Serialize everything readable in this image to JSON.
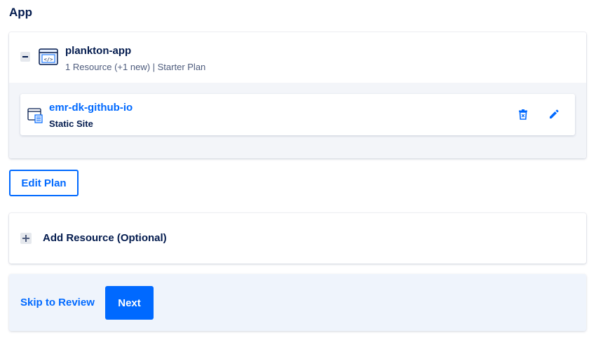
{
  "section": {
    "title": "App"
  },
  "app": {
    "name": "plankton-app",
    "meta": "1 Resource (+1 new) | Starter Plan",
    "icon": "code-window-icon",
    "collapse_icon": "minus-icon"
  },
  "resource": {
    "name": "emr-dk-github-io",
    "type": "Static Site",
    "icon": "static-site-icon",
    "actions": {
      "delete_icon": "trash-icon",
      "edit_icon": "pencil-icon"
    }
  },
  "buttons": {
    "edit_plan": "Edit Plan",
    "add_resource": "Add Resource (Optional)",
    "skip_to_review": "Skip to Review",
    "next": "Next"
  },
  "colors": {
    "primary": "#0069ff",
    "text": "#031b4e",
    "muted": "#4d5b7c",
    "panel_bg": "#f3f5f9",
    "footer_bg": "#eff4fc"
  }
}
